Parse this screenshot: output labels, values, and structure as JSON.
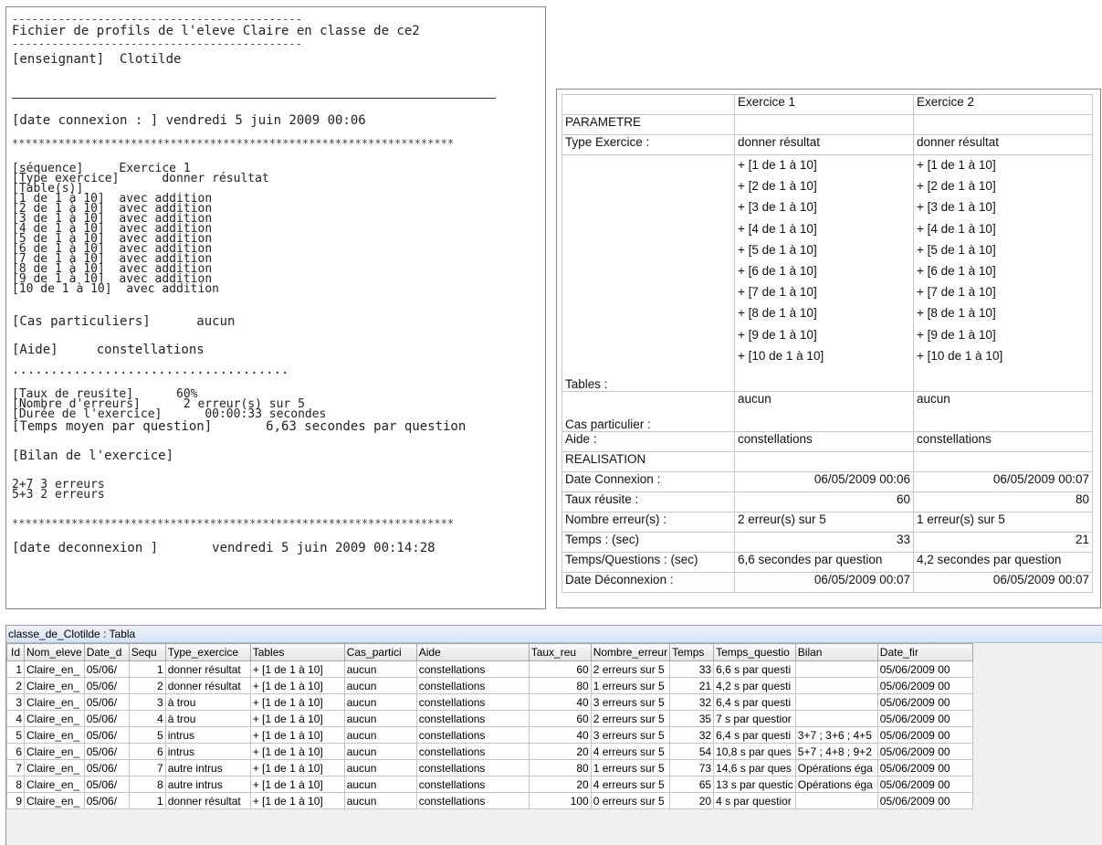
{
  "text_file": {
    "dash_top": "--------------------------------------------",
    "title": "Fichier de profils de l'eleve Claire en classe de ce2",
    "dash_mid": "--------------------------------------------",
    "teacher": "[enseignant]  Clotilde",
    "date_connexion": "[date connexion : ] vendredi 5 juin 2009 00:06",
    "stars": "*******************************************************************",
    "sequence": "[séquence]     Exercice 1",
    "type_exercice": "[Type exercice]      donner résultat",
    "tables_header": "[Table(s)]",
    "table_lines": [
      "[1 de 1 à 10]  avec addition",
      "[2 de 1 à 10]  avec addition",
      "[3 de 1 à 10]  avec addition",
      "[4 de 1 à 10]  avec addition",
      "[5 de 1 à 10]  avec addition",
      "[6 de 1 à 10]  avec addition",
      "[7 de 1 à 10]  avec addition",
      "[8 de 1 à 10]  avec addition",
      "[9 de 1 à 10]  avec addition",
      "[10 de 1 à 10]  avec addition"
    ],
    "cas_particuliers": "[Cas particuliers]      aucun",
    "aide": "[Aide]     constellations",
    "dots": "....................................",
    "taux": "[Taux de reusite]      60%",
    "nombre_erreurs": "[Nombre d'erreurs]      2 erreur(s) sur 5",
    "duree": "[Durée de l'exercice]      00:00:33 secondes",
    "temps_moyen": "[Temps moyen par question]       6,63 secondes par question",
    "bilan": "[Bilan de l'exercice]",
    "bilan_1": "2+7 3 erreurs",
    "bilan_2": "5+3 2 erreurs",
    "stars2": "*******************************************************************",
    "date_deconnexion": "[date deconnexion ]       vendredi 5 juin 2009 00:14:28"
  },
  "grid": {
    "col_ex1": "Exercice 1",
    "col_ex2": "Exercice 2",
    "parametre": "PARAMETRE",
    "type_label": "Type Exercice :",
    "type_ex1": "donner résultat",
    "type_ex2": "donner résultat",
    "tables_label": "Tables :",
    "tables": [
      "+ [1 de 1 à 10]",
      "+ [2 de 1 à 10]",
      "+ [3 de 1 à 10]",
      "+ [4 de 1 à 10]",
      "+ [5 de 1 à 10]",
      "+ [6 de 1 à 10]",
      "+ [7 de 1 à 10]",
      "+ [8 de 1 à 10]",
      "+ [9 de 1 à 10]",
      "+ [10 de 1 à 10]"
    ],
    "cas_label": "Cas particulier :",
    "cas_ex1": "aucun",
    "cas_ex2": "aucun",
    "aide_label": "Aide :",
    "aide_ex1": "constellations",
    "aide_ex2": "constellations",
    "realisation": "REALISATION",
    "date_cx_label": "Date Connexion :",
    "date_cx_ex1": "06/05/2009 00:06",
    "date_cx_ex2": "06/05/2009 00:07",
    "taux_label": "Taux réusite :",
    "taux_ex1": "60",
    "taux_ex2": "80",
    "nberr_label": "Nombre erreur(s) :",
    "nberr_ex1": "2 erreur(s) sur 5",
    "nberr_ex2": "1 erreur(s) sur 5",
    "temps_label": "Temps : (sec)",
    "temps_ex1": "33",
    "temps_ex2": "21",
    "tq_label": "Temps/Questions : (sec)",
    "tq_ex1": "6,6 secondes par question",
    "tq_ex2": "4,2 secondes par question",
    "date_dc_label": "Date Déconnexion :",
    "date_dc_ex1": "06/05/2009 00:07",
    "date_dc_ex2": "06/05/2009 00:07"
  },
  "datasheet": {
    "title": "classe_de_Clotilde : Tabla",
    "columns": [
      "Id",
      "Nom_eleve",
      "Date_d",
      "Sequ",
      "Type_exercice",
      "Tables",
      "Cas_partici",
      "Aide",
      "Taux_reu",
      "Nombre_erreur",
      "Temps",
      "Temps_questio",
      "Bilan",
      "Date_fir"
    ],
    "rows": [
      {
        "id": "1",
        "nom": "Claire_en_",
        "date": "05/06/",
        "seq": "1",
        "type": "donner résultat",
        "tables": "+ [1 de 1 à 10]",
        "cas": "aucun",
        "aide": "constellations",
        "taux": "60",
        "nberr": "2 erreurs sur 5",
        "temps": "33",
        "tq": "6,6 s par questi",
        "bilan": "",
        "datefin": "05/06/2009 00"
      },
      {
        "id": "2",
        "nom": "Claire_en_",
        "date": "05/06/",
        "seq": "2",
        "type": "donner résultat",
        "tables": "+ [1 de 1 à 10]",
        "cas": "aucun",
        "aide": "constellations",
        "taux": "80",
        "nberr": "1 erreurs sur 5",
        "temps": "21",
        "tq": "4,2 s par questi",
        "bilan": "",
        "datefin": "05/06/2009 00"
      },
      {
        "id": "3",
        "nom": "Claire_en_",
        "date": "05/06/",
        "seq": "3",
        "type": "à trou",
        "tables": "+ [1 de 1 à 10]",
        "cas": "aucun",
        "aide": "constellations",
        "taux": "40",
        "nberr": "3 erreurs sur 5",
        "temps": "32",
        "tq": "6,4 s par questi",
        "bilan": "",
        "datefin": "05/06/2009 00"
      },
      {
        "id": "4",
        "nom": "Claire_en_",
        "date": "05/06/",
        "seq": "4",
        "type": "à trou",
        "tables": "+ [1 de 1 à 10]",
        "cas": "aucun",
        "aide": "constellations",
        "taux": "60",
        "nberr": "2 erreurs sur 5",
        "temps": "35",
        "tq": "7 s par questior",
        "bilan": "",
        "datefin": "05/06/2009 00"
      },
      {
        "id": "5",
        "nom": "Claire_en_",
        "date": "05/06/",
        "seq": "5",
        "type": "intrus",
        "tables": "+ [1 de 1 à 10]",
        "cas": "aucun",
        "aide": "constellations",
        "taux": "40",
        "nberr": "3 erreurs sur 5",
        "temps": "32",
        "tq": "6,4 s par questi",
        "bilan": "3+7 ; 3+6 ; 4+5",
        "datefin": "05/06/2009 00"
      },
      {
        "id": "6",
        "nom": "Claire_en_",
        "date": "05/06/",
        "seq": "6",
        "type": "intrus",
        "tables": "+ [1 de 1 à 10]",
        "cas": "aucun",
        "aide": "constellations",
        "taux": "20",
        "nberr": "4 erreurs sur 5",
        "temps": "54",
        "tq": "10,8 s par ques",
        "bilan": "5+7 ; 4+8 ; 9+2",
        "datefin": "05/06/2009 00"
      },
      {
        "id": "7",
        "nom": "Claire_en_",
        "date": "05/06/",
        "seq": "7",
        "type": "autre intrus",
        "tables": "+ [1 de 1 à 10]",
        "cas": "aucun",
        "aide": "constellations",
        "taux": "80",
        "nberr": "1 erreurs sur 5",
        "temps": "73",
        "tq": "14,6 s par ques",
        "bilan": "Opérations éga",
        "datefin": "05/06/2009 00"
      },
      {
        "id": "8",
        "nom": "Claire_en_",
        "date": "05/06/",
        "seq": "8",
        "type": "autre intrus",
        "tables": "+ [1 de 1 à 10]",
        "cas": "aucun",
        "aide": "constellations",
        "taux": "20",
        "nberr": "4 erreurs sur 5",
        "temps": "65",
        "tq": "13 s par questic",
        "bilan": "Opérations éga",
        "datefin": "05/06/2009 00"
      },
      {
        "id": "9",
        "nom": "Claire_en_",
        "date": "05/06/",
        "seq": "1",
        "type": "donner résultat",
        "tables": "+ [1 de 1 à 10]",
        "cas": "aucun",
        "aide": "constellations",
        "taux": "100",
        "nberr": "0 erreurs sur 5",
        "temps": "20",
        "tq": "4 s par questior",
        "bilan": "",
        "datefin": "05/06/2009 00"
      }
    ]
  }
}
